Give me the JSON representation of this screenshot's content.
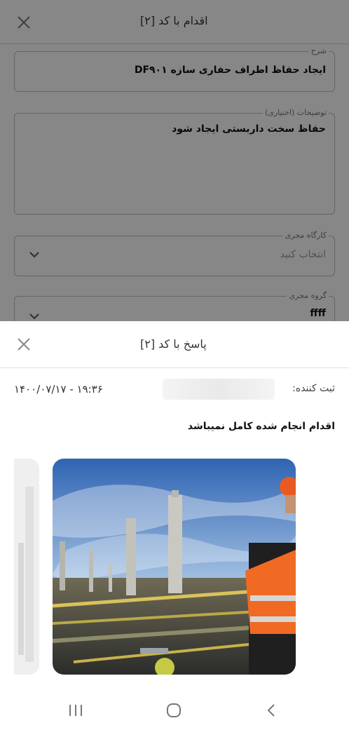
{
  "background_form": {
    "title": "اقدام با کد [۲]",
    "fields": [
      {
        "label": "شرح",
        "value": "ایجاد حفاظ اطراف حفاری سازه DF۹۰۱"
      },
      {
        "label": "توضیحات (اختیاری)",
        "value": "حفاظ سخت داربستی ایجاد شود"
      },
      {
        "label": "کارگاه مجری",
        "placeholder": "انتخاب کنید"
      },
      {
        "label": "گروه مجری",
        "value": "ffff"
      }
    ]
  },
  "sheet": {
    "title": "پاسخ با کد [۲]",
    "recorder_label": "ثبت کننده:",
    "datetime": "۱۹:۳۶ - ۱۴۰۰/۰۷/۱۷",
    "response_text": "اقدام انجام شده کامل نمیباشد",
    "images": [
      {
        "alt": "refinery-with-worker-photo"
      },
      {
        "alt": "partial-photo"
      }
    ]
  },
  "navbar": {
    "icons": [
      "recent-apps-icon",
      "home-icon",
      "back-icon"
    ]
  },
  "colors": {
    "overlay": "#000000",
    "text_dark": "#222222",
    "border": "#bdbdbd"
  }
}
